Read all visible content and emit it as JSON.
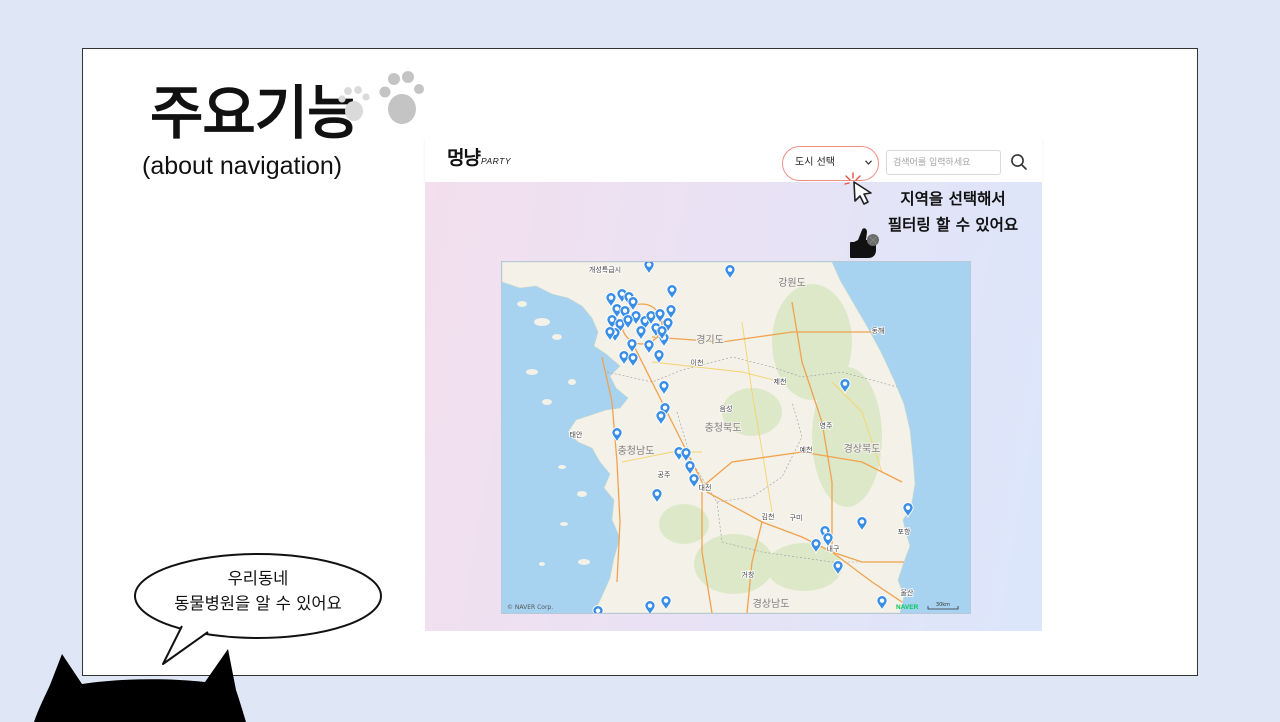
{
  "slide": {
    "title": "주요기능",
    "subtitle": "(about navigation)"
  },
  "app": {
    "logo": {
      "main": "멍냥",
      "sub": "PARTY"
    },
    "city_select": {
      "selected": "도시 선택"
    },
    "search": {
      "placeholder": "검색어를 입력하세요"
    }
  },
  "filter_callout": {
    "line1": "지역을 선택해서",
    "line2": "필터링 할 수 있어요"
  },
  "speech_bubble": {
    "line1": "우리동네",
    "line2": "동물병원을 알 수 있어요"
  },
  "map": {
    "provinces": [
      "강원도",
      "경기도",
      "충청북도",
      "충청남도",
      "경상북도",
      "경상남도"
    ],
    "cities": [
      "개성특급시",
      "대구",
      "울산",
      "영주",
      "제천",
      "음성",
      "이천",
      "공주",
      "대전",
      "김천",
      "구미",
      "예천",
      "포항",
      "거창",
      "태안",
      "동해"
    ],
    "copyright": "© NAVER Corp.",
    "brand": "NAVER",
    "scale_label": "30km"
  },
  "icons": {
    "decoration": "paw-print-icon",
    "select_arrow": "chevron-down-icon",
    "search": "search-icon",
    "pointer": "mouse-cursor-icon",
    "thumbs_up": "thumbs-up-icon",
    "marker": "map-pin-icon",
    "mascot": "cat-silhouette"
  },
  "colors": {
    "page_background": "#dfe7f7",
    "highlight_ring": "#ee8f86",
    "map_pin": "#3a8ee6",
    "sea": "#a7d3f1",
    "land": "#f3f1e8",
    "naver_green": "#03c75a"
  }
}
